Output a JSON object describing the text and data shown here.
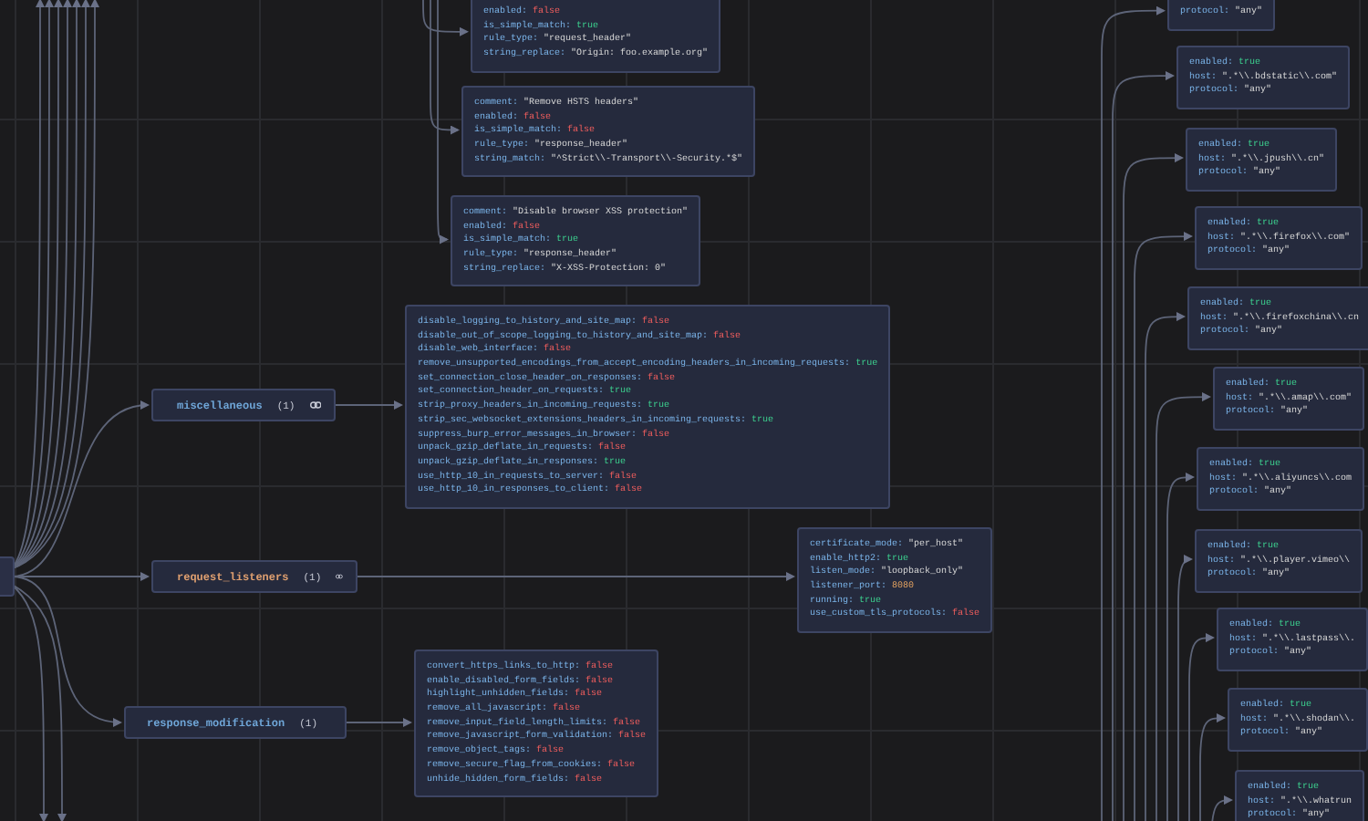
{
  "rules": [
    {
      "rows": [
        {
          "key": "enabled:",
          "value": "false",
          "kind": "bool_false"
        },
        {
          "key": "is_simple_match:",
          "value": "true",
          "kind": "bool_true"
        },
        {
          "key": "rule_type:",
          "value": "\"request_header\"",
          "kind": "string"
        },
        {
          "key": "string_replace:",
          "value": "\"Origin: foo.example.org\"",
          "kind": "string"
        }
      ]
    },
    {
      "rows": [
        {
          "key": "comment:",
          "value": "\"Remove HSTS headers\"",
          "kind": "string"
        },
        {
          "key": "enabled:",
          "value": "false",
          "kind": "bool_false"
        },
        {
          "key": "is_simple_match:",
          "value": "false",
          "kind": "bool_false"
        },
        {
          "key": "rule_type:",
          "value": "\"response_header\"",
          "kind": "string"
        },
        {
          "key": "string_match:",
          "value": "\"^Strict\\\\-Transport\\\\-Security.*$\"",
          "kind": "string"
        }
      ]
    },
    {
      "rows": [
        {
          "key": "comment:",
          "value": "\"Disable browser XSS protection\"",
          "kind": "string"
        },
        {
          "key": "enabled:",
          "value": "false",
          "kind": "bool_false"
        },
        {
          "key": "is_simple_match:",
          "value": "true",
          "kind": "bool_true"
        },
        {
          "key": "rule_type:",
          "value": "\"response_header\"",
          "kind": "string"
        },
        {
          "key": "string_replace:",
          "value": "\"X-XSS-Protection: 0\"",
          "kind": "string"
        }
      ]
    }
  ],
  "sections": [
    {
      "label": "miscellaneous",
      "count": "(1)",
      "color": "#6fa6d8",
      "child_rows": [
        {
          "key": "disable_logging_to_history_and_site_map:",
          "value": "false",
          "kind": "bool_false"
        },
        {
          "key": "disable_out_of_scope_logging_to_history_and_site_map:",
          "value": "false",
          "kind": "bool_false"
        },
        {
          "key": "disable_web_interface:",
          "value": "false",
          "kind": "bool_false"
        },
        {
          "key": "remove_unsupported_encodings_from_accept_encoding_headers_in_incoming_requests:",
          "value": "true",
          "kind": "bool_true"
        },
        {
          "key": "set_connection_close_header_on_responses:",
          "value": "false",
          "kind": "bool_false"
        },
        {
          "key": "set_connection_header_on_requests:",
          "value": "true",
          "kind": "bool_true"
        },
        {
          "key": "strip_proxy_headers_in_incoming_requests:",
          "value": "true",
          "kind": "bool_true"
        },
        {
          "key": "strip_sec_websocket_extensions_headers_in_incoming_requests:",
          "value": "true",
          "kind": "bool_true"
        },
        {
          "key": "suppress_burp_error_messages_in_browser:",
          "value": "false",
          "kind": "bool_false"
        },
        {
          "key": "unpack_gzip_deflate_in_requests:",
          "value": "false",
          "kind": "bool_false"
        },
        {
          "key": "unpack_gzip_deflate_in_responses:",
          "value": "true",
          "kind": "bool_true"
        },
        {
          "key": "use_http_10_in_requests_to_server:",
          "value": "false",
          "kind": "bool_false"
        },
        {
          "key": "use_http_10_in_responses_to_client:",
          "value": "false",
          "kind": "bool_false"
        }
      ]
    },
    {
      "label": "request_listeners",
      "count": "(1)",
      "color": "#e0a070",
      "child_rows": [
        {
          "key": "certificate_mode:",
          "value": "\"per_host\"",
          "kind": "string"
        },
        {
          "key": "enable_http2:",
          "value": "true",
          "kind": "bool_true"
        },
        {
          "key": "listen_mode:",
          "value": "\"loopback_only\"",
          "kind": "string"
        },
        {
          "key": "listener_port:",
          "value": "8080",
          "kind": "number"
        },
        {
          "key": "running:",
          "value": "true",
          "kind": "bool_true"
        },
        {
          "key": "use_custom_tls_protocols:",
          "value": "false",
          "kind": "bool_false"
        }
      ]
    },
    {
      "label": "response_modification",
      "count": "(1)",
      "color": "#6fa6d8",
      "child_rows": [
        {
          "key": "convert_https_links_to_http:",
          "value": "false",
          "kind": "bool_false"
        },
        {
          "key": "enable_disabled_form_fields:",
          "value": "false",
          "kind": "bool_false"
        },
        {
          "key": "highlight_unhidden_fields:",
          "value": "false",
          "kind": "bool_false"
        },
        {
          "key": "remove_all_javascript:",
          "value": "false",
          "kind": "bool_false"
        },
        {
          "key": "remove_input_field_length_limits:",
          "value": "false",
          "kind": "bool_false"
        },
        {
          "key": "remove_javascript_form_validation:",
          "value": "false",
          "kind": "bool_false"
        },
        {
          "key": "remove_object_tags:",
          "value": "false",
          "kind": "bool_false"
        },
        {
          "key": "remove_secure_flag_from_cookies:",
          "value": "false",
          "kind": "bool_false"
        },
        {
          "key": "unhide_hidden_form_fields:",
          "value": "false",
          "kind": "bool_false"
        }
      ]
    }
  ],
  "hosts": [
    {
      "rows": [
        {
          "key": "protocol:",
          "value": "\"any\"",
          "kind": "string"
        }
      ]
    },
    {
      "rows": [
        {
          "key": "enabled:",
          "value": "true",
          "kind": "bool_true"
        },
        {
          "key": "host:",
          "value": "\".*\\\\.bdstatic\\\\.com\"",
          "kind": "string"
        },
        {
          "key": "protocol:",
          "value": "\"any\"",
          "kind": "string"
        }
      ]
    },
    {
      "rows": [
        {
          "key": "enabled:",
          "value": "true",
          "kind": "bool_true"
        },
        {
          "key": "host:",
          "value": "\".*\\\\.jpush\\\\.cn\"",
          "kind": "string"
        },
        {
          "key": "protocol:",
          "value": "\"any\"",
          "kind": "string"
        }
      ]
    },
    {
      "rows": [
        {
          "key": "enabled:",
          "value": "true",
          "kind": "bool_true"
        },
        {
          "key": "host:",
          "value": "\".*\\\\.firefox\\\\.com\"",
          "kind": "string"
        },
        {
          "key": "protocol:",
          "value": "\"any\"",
          "kind": "string"
        }
      ]
    },
    {
      "rows": [
        {
          "key": "enabled:",
          "value": "true",
          "kind": "bool_true"
        },
        {
          "key": "host:",
          "value": "\".*\\\\.firefoxchina\\\\.cn",
          "kind": "string"
        },
        {
          "key": "protocol:",
          "value": "\"any\"",
          "kind": "string"
        }
      ]
    },
    {
      "rows": [
        {
          "key": "enabled:",
          "value": "true",
          "kind": "bool_true"
        },
        {
          "key": "host:",
          "value": "\".*\\\\.amap\\\\.com\"",
          "kind": "string"
        },
        {
          "key": "protocol:",
          "value": "\"any\"",
          "kind": "string"
        }
      ]
    },
    {
      "rows": [
        {
          "key": "enabled:",
          "value": "true",
          "kind": "bool_true"
        },
        {
          "key": "host:",
          "value": "\".*\\\\.aliyuncs\\\\.com",
          "kind": "string"
        },
        {
          "key": "protocol:",
          "value": "\"any\"",
          "kind": "string"
        }
      ]
    },
    {
      "rows": [
        {
          "key": "enabled:",
          "value": "true",
          "kind": "bool_true"
        },
        {
          "key": "host:",
          "value": "\".*\\\\.player.vimeo\\\\",
          "kind": "string"
        },
        {
          "key": "protocol:",
          "value": "\"any\"",
          "kind": "string"
        }
      ]
    },
    {
      "rows": [
        {
          "key": "enabled:",
          "value": "true",
          "kind": "bool_true"
        },
        {
          "key": "host:",
          "value": "\".*\\\\.lastpass\\\\.",
          "kind": "string"
        },
        {
          "key": "protocol:",
          "value": "\"any\"",
          "kind": "string"
        }
      ]
    },
    {
      "rows": [
        {
          "key": "enabled:",
          "value": "true",
          "kind": "bool_true"
        },
        {
          "key": "host:",
          "value": "\".*\\\\.shodan\\\\.",
          "kind": "string"
        },
        {
          "key": "protocol:",
          "value": "\"any\"",
          "kind": "string"
        }
      ]
    },
    {
      "rows": [
        {
          "key": "enabled:",
          "value": "true",
          "kind": "bool_true"
        },
        {
          "key": "host:",
          "value": "\".*\\\\.whatrun",
          "kind": "string"
        },
        {
          "key": "protocol:",
          "value": "\"any\"",
          "kind": "string"
        }
      ]
    }
  ]
}
